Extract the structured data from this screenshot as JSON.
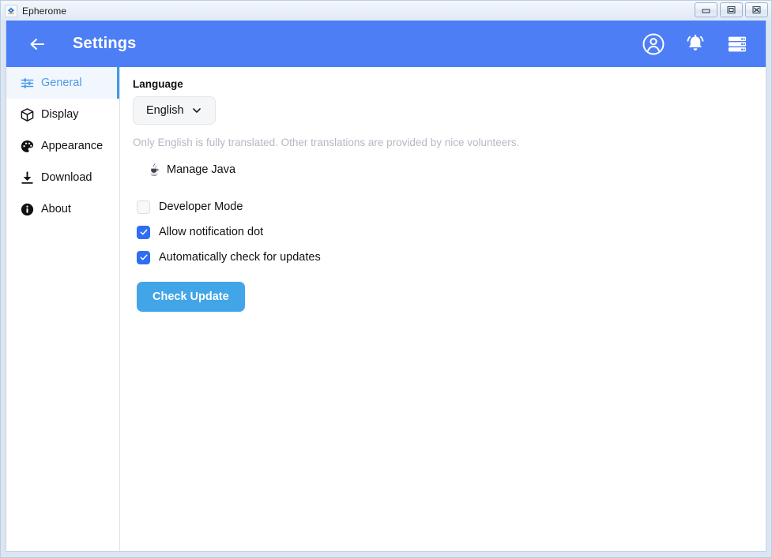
{
  "titlebar": {
    "app_title": "Epherome",
    "app_icon": "app-logo-icon",
    "buttons": [
      {
        "name": "minimize",
        "icon": "minimize-icon"
      },
      {
        "name": "maximize",
        "icon": "maximize-icon"
      },
      {
        "name": "close",
        "icon": "close-icon"
      }
    ]
  },
  "header": {
    "back_icon": "arrow-left-icon",
    "title": "Settings",
    "accent_color": "#4d7ef6",
    "actions": [
      {
        "name": "account",
        "icon": "account-circle-icon"
      },
      {
        "name": "notifications",
        "icon": "bell-ring-icon"
      },
      {
        "name": "servers",
        "icon": "server-stack-icon"
      }
    ]
  },
  "sidebar": {
    "items": [
      {
        "label": "General",
        "icon": "tune-sliders-icon",
        "active": true
      },
      {
        "label": "Display",
        "icon": "cube-icon",
        "active": false
      },
      {
        "label": "Appearance",
        "icon": "palette-icon",
        "active": false
      },
      {
        "label": "Download",
        "icon": "download-icon",
        "active": false
      },
      {
        "label": "About",
        "icon": "info-circle-icon",
        "active": false
      }
    ],
    "active_color": "#4a9bec",
    "indicator_color": "#3f9ae8"
  },
  "main": {
    "language_label": "Language",
    "language_value": "English",
    "language_caret": "chevron-down-icon",
    "language_hint": "Only English is fully translated. Other translations are provided by nice volunteers.",
    "manage_java_label": "Manage Java",
    "manage_java_icon": "java-cup-icon",
    "checkboxes": [
      {
        "label": "Developer Mode",
        "checked": false
      },
      {
        "label": "Allow notification dot",
        "checked": true
      },
      {
        "label": "Automatically check for updates",
        "checked": true
      }
    ],
    "check_update_label": "Check Update",
    "check_update_color": "#42a5e8",
    "checkbox_checked_color": "#2f6df5"
  }
}
